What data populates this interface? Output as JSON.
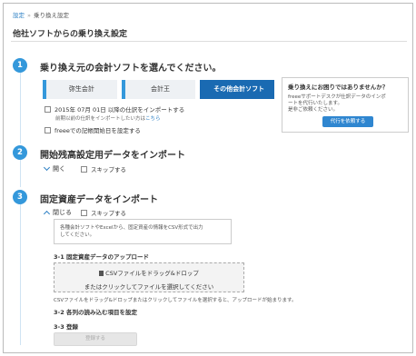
{
  "breadcrumb": {
    "home": "設定",
    "separator": "»",
    "current": "乗り換え設定"
  },
  "page_title": "他社ソフトからの乗り換え設定",
  "step1": {
    "number": "1",
    "title": "乗り換え元の会計ソフトを選んでください。",
    "tabs": [
      {
        "label": "弥生会計",
        "active": false
      },
      {
        "label": "会計王",
        "active": false
      },
      {
        "label": "その他会計ソフト",
        "active": true
      }
    ],
    "option1_label": "2015年 07月 01日 以降の仕訳をインポートする",
    "option1_note": "前期以前の仕訳をインポートしたい方は",
    "option1_note_link": "こちら",
    "option2_label": "freeeでの記帳開始日を設定する"
  },
  "help": {
    "title": "乗り換えにお困りではありませんか？",
    "text_line1": "freeeサポートデスクが仕訳データのインポ",
    "text_line2": "ートを代行いたします。",
    "text_line3": "是非ご依頼ください。",
    "button": "代行を依頼する"
  },
  "step2": {
    "number": "2",
    "title": "開始残高設定用データをインポート",
    "toggle_label": "開く",
    "skip_label": "スキップする"
  },
  "step3": {
    "number": "3",
    "title": "固定資産データをインポート",
    "toggle_label": "閉じる",
    "skip_label": "スキップする",
    "info_line1": "各種会計ソフトやExcelから、固定資産の情報をCSV形式で出力",
    "info_line2": "してください。",
    "sub1": "3-1 固定資産データのアップロード",
    "drop_line1": "CSVファイルをドラッグ&ドロップ",
    "drop_line2": "またはクリックしてファイルを選択してください",
    "drop_caption": "CSVファイルをドラッグ&ドロップまたはクリックしてファイルを選択すると、アップロードが始まります。",
    "sub2": "3-2 各列の読み込む項目を設定",
    "sub3": "3-3 登録",
    "register_button": "登録する"
  }
}
